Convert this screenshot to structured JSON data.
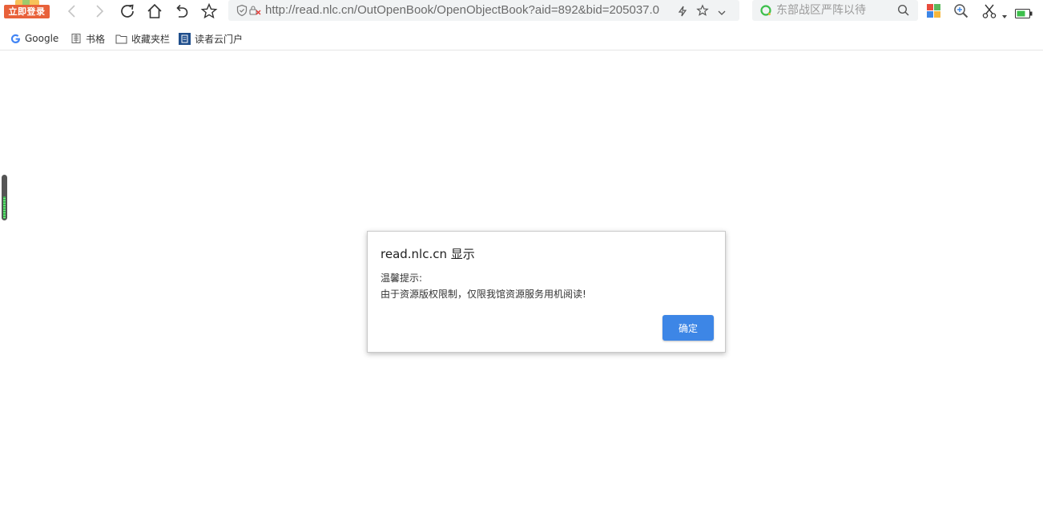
{
  "toolbar": {
    "login_badge": "立即登录",
    "url": "http://read.nlc.cn/OutOpenBook/OpenObjectBook?aid=892&bid=205037.0",
    "search_placeholder": "东部战区严阵以待"
  },
  "bookmarks": [
    {
      "label": "Google",
      "icon": "google-icon"
    },
    {
      "label": "书格",
      "icon": "shuge-icon"
    },
    {
      "label": "收藏夹栏",
      "icon": "folder-icon"
    },
    {
      "label": "读者云门户",
      "icon": "reader-cloud-icon"
    }
  ],
  "dialog": {
    "title": "read.nlc.cn 显示",
    "message_line1": "温馨提示:",
    "message_line2": "由于资源版权限制，仅限我馆资源服务用机阅读!",
    "ok_label": "确定"
  },
  "colors": {
    "accent": "#3d86e6",
    "login_badge": "#e8613a"
  }
}
